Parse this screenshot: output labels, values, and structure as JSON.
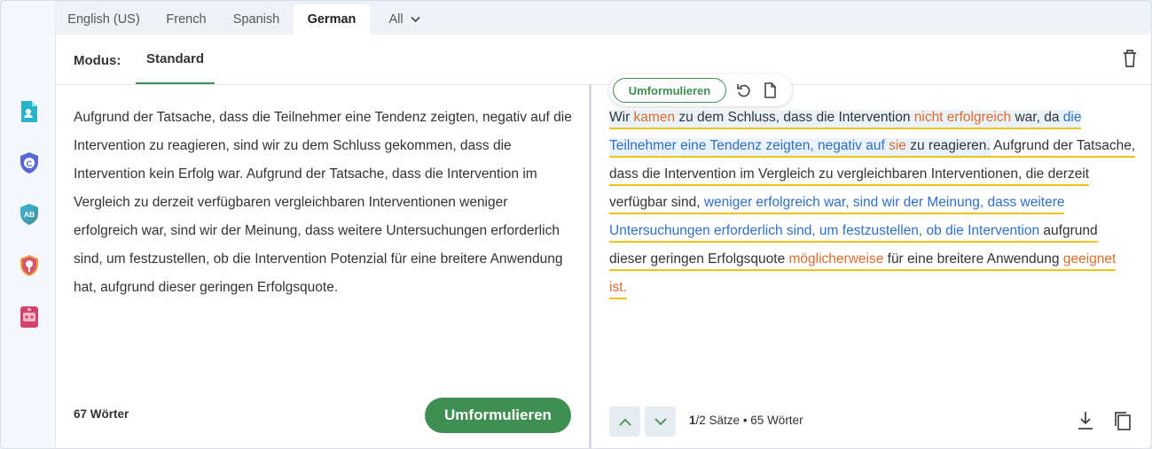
{
  "tabs": [
    {
      "label": "English (US)"
    },
    {
      "label": "French"
    },
    {
      "label": "Spanish"
    },
    {
      "label": "German"
    },
    {
      "label": "All"
    }
  ],
  "active_tab": "German",
  "modus": {
    "label": "Modus:",
    "active_mode": "Standard"
  },
  "sidebar_icons": [
    "document-user-icon",
    "shield-c-icon",
    "ab-shield-icon",
    "magnifier-badge-icon",
    "robot-icon"
  ],
  "input": {
    "text": "Aufgrund der Tatsache, dass die Teilnehmer eine Tendenz zeigten, negativ auf die Intervention zu reagieren, sind wir zu dem Schluss gekommen, dass die Intervention kein Erfolg war. Aufgrund der Tatsache, dass die Intervention im Vergleich zu derzeit verfügbaren vergleichbaren Interventionen weniger erfolgreich war, sind wir der Meinung, dass weitere Untersuchungen erforderlich sind, um festzustellen, ob die Intervention Potenzial für eine breitere Anwendung hat, aufgrund dieser geringen Erfolgsquote.",
    "word_count": "67 Wörter",
    "paraphrase_button": "Umformulieren"
  },
  "output": {
    "floating_button": "Umformulieren",
    "segments": [
      {
        "text": "Wir ",
        "style": "dark",
        "sentence": 1
      },
      {
        "text": "kamen",
        "style": "orange",
        "sentence": 1
      },
      {
        "text": " zu dem Schluss, dass die Intervention ",
        "style": "dark",
        "sentence": 1
      },
      {
        "text": "nicht erfolgreich",
        "style": "orange",
        "sentence": 1
      },
      {
        "text": " war, da ",
        "style": "dark",
        "sentence": 1
      },
      {
        "text": "die Teilnehmer eine Tendenz zeigten, negativ auf ",
        "style": "blue",
        "sentence": 1
      },
      {
        "text": "sie",
        "style": "orange",
        "sentence": 1
      },
      {
        "text": " zu reagieren",
        "style": "dark",
        "sentence": 1
      },
      {
        "text": ".",
        "style": "dark",
        "sentence": 1
      },
      {
        "text": " Aufgrund der Tatsache, dass die Intervention im Vergleich zu vergleichbaren Interventionen, die derzeit verfügbar sind, ",
        "style": "dark",
        "sentence": 2
      },
      {
        "text": "weniger erfolgreich war, sind wir der Meinung, dass weitere Untersuchungen erforderlich sind, um festzustellen, ob die Intervention",
        "style": "blue",
        "sentence": 2
      },
      {
        "text": " aufgrund dieser geringen Erfolgsquote ",
        "style": "dark",
        "sentence": 2
      },
      {
        "text": "möglicherweise",
        "style": "orange",
        "sentence": 2
      },
      {
        "text": " für eine breitere Anwendung ",
        "style": "dark",
        "sentence": 2
      },
      {
        "text": "geeignet ist.",
        "style": "orange",
        "sentence": 2
      }
    ],
    "sentence_current": "1",
    "sentence_rest": "/2 Sätze",
    "word_count": "65 Wörter"
  },
  "colors": {
    "accent_green": "#3f8e52",
    "changed_word_orange": "#dd6b2e",
    "restructured_blue": "#2f6fc5",
    "underline_yellow": "#f0c419",
    "highlight_bg": "#eaf3fa"
  }
}
